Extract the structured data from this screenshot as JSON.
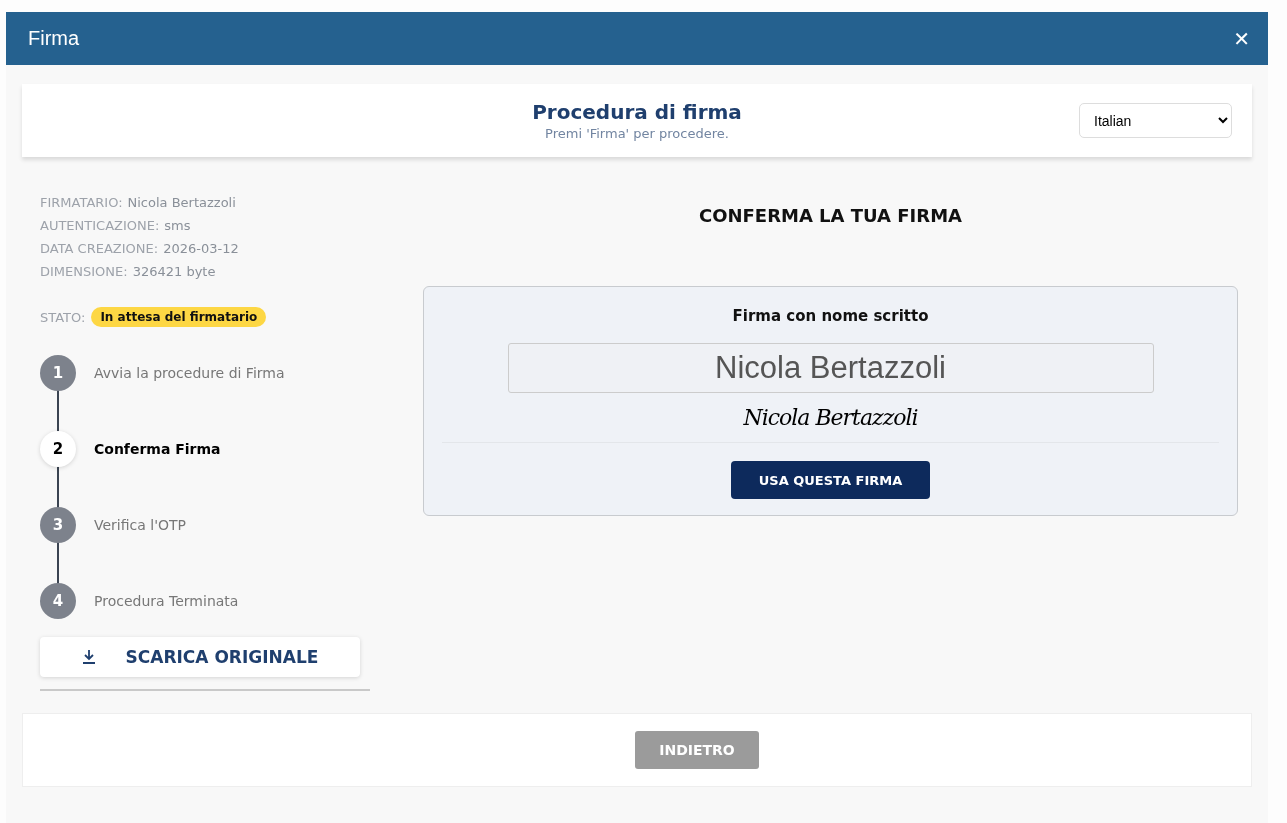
{
  "window": {
    "title": "Firma",
    "close": "✕"
  },
  "header": {
    "title": "Procedura di firma",
    "subtitle": "Premi 'Firma' per procedere.",
    "language": "Italian"
  },
  "info": [
    {
      "label": "FIRMATARIO:",
      "value": "Nicola Bertazzoli"
    },
    {
      "label": "AUTENTICAZIONE:",
      "value": "sms"
    },
    {
      "label": "DATA CREAZIONE:",
      "value": "2026-03-12"
    },
    {
      "label": "DIMENSIONE:",
      "value": "326421 byte"
    }
  ],
  "status": {
    "label": "STATO:",
    "value": "In attesa del firmatario"
  },
  "steps": [
    {
      "number": "1",
      "label": "Avvia la procedure di Firma",
      "selected": false
    },
    {
      "number": "2",
      "label": "Conferma Firma",
      "selected": true
    },
    {
      "number": "3",
      "label": "Verifica l'OTP",
      "selected": false
    },
    {
      "number": "4",
      "label": "Procedura Terminata",
      "selected": false
    }
  ],
  "download_button": "SCARICA ORIGINALE",
  "main": {
    "heading": "CONFERMA LA TUA FIRMA",
    "card_title": "Firma con nome scritto",
    "name_value": "Nicola Bertazzoli",
    "signature_preview": "Nicola Bertazzoli",
    "use_button": "USA QUESTA FIRMA"
  },
  "footer": {
    "back_button": "INDIETRO"
  }
}
